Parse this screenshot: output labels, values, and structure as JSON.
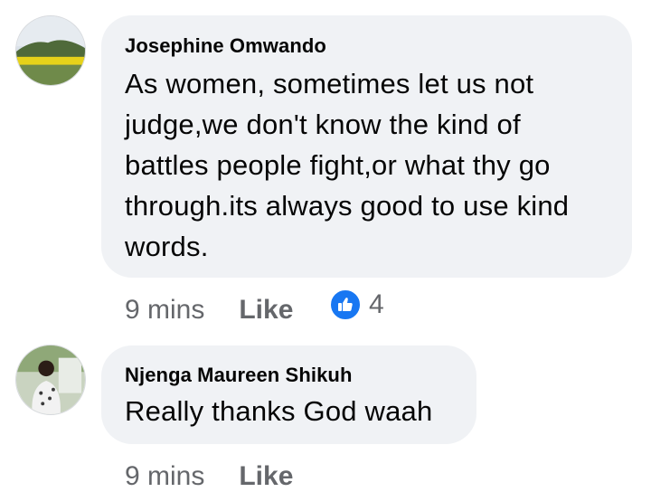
{
  "comments": [
    {
      "author": "Josephine Omwando",
      "text_lines": [
        "As women, sometimes let us not",
        "judge,we don't know the kind of",
        "battles people fight,or what thy go",
        "through.its always good to use kind",
        "words."
      ],
      "time": "9 mins",
      "like_label": "Like",
      "reaction_count": "4",
      "reaction_icon": "thumbs-up-icon"
    },
    {
      "author": "Njenga Maureen Shikuh",
      "text_lines": [
        "Really thanks God waah"
      ],
      "time": "9 mins",
      "like_label": "Like"
    }
  ],
  "colors": {
    "bubble": "#f0f2f5",
    "meta_text": "#65676b",
    "like_blue": "#1877f2"
  }
}
